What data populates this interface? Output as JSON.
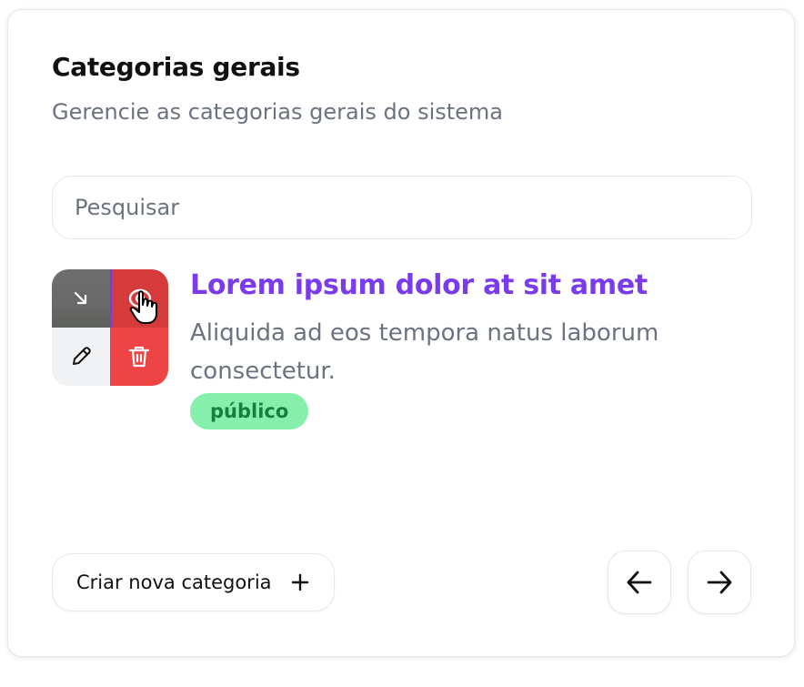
{
  "header": {
    "title": "Categorias gerais",
    "subtitle": "Gerencie as categorias gerais do sistema"
  },
  "search": {
    "placeholder": "Pesquisar",
    "value": ""
  },
  "category_item": {
    "title": "Lorem ipsum dolor at sit amet",
    "description": "Aliquida ad eos tempora natus laborum consectetur.",
    "badge": "público",
    "actions": [
      "expand-icon",
      "eye-icon",
      "pencil-icon",
      "trash-icon"
    ]
  },
  "footer": {
    "create_label": "Criar nova categoria",
    "create_icon": "plus-icon",
    "prev_icon": "arrow-left-icon",
    "next_icon": "arrow-right-icon"
  },
  "colors": {
    "accent": "#7c3aed",
    "danger": "#ef4444",
    "badge_bg": "#86efac",
    "badge_text": "#15803d",
    "muted_text": "#6b7280"
  }
}
